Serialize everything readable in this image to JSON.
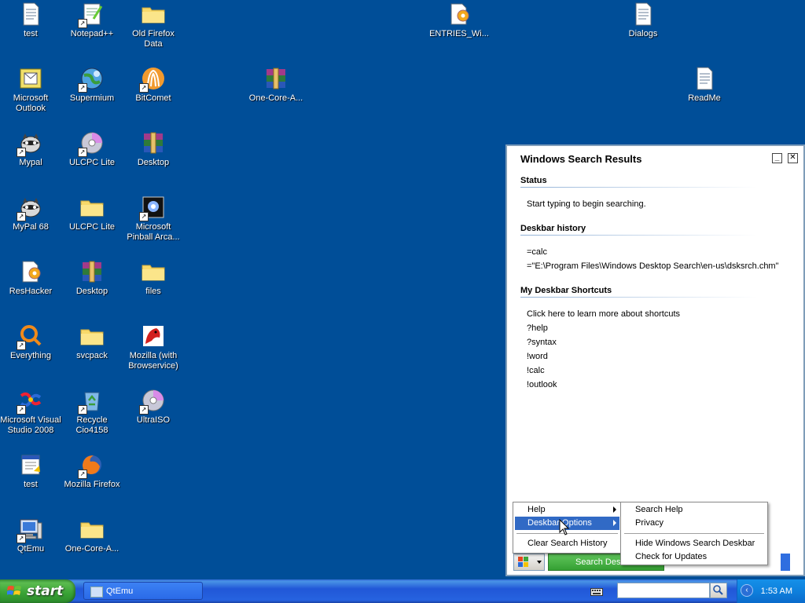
{
  "desktop": {
    "icons": [
      {
        "id": "test1",
        "label": "test",
        "kind": "doc"
      },
      {
        "id": "notepadpp",
        "label": "Notepad++",
        "kind": "notepad"
      },
      {
        "id": "oldfirefox",
        "label": "Old Firefox Data",
        "kind": "folder"
      },
      {
        "id": "entries",
        "label": "ENTRIES_Wi...",
        "kind": "reshack"
      },
      {
        "id": "dialogs",
        "label": "Dialogs",
        "kind": "doc"
      },
      {
        "id": "outlook",
        "label": "Microsoft Outlook",
        "kind": "outlook"
      },
      {
        "id": "supermium",
        "label": "Supermium",
        "kind": "globe"
      },
      {
        "id": "bitcomet",
        "label": "BitComet",
        "kind": "bitcomet"
      },
      {
        "id": "onecore1",
        "label": "One-Core-A...",
        "kind": "rar"
      },
      {
        "id": "readme",
        "label": "ReadMe",
        "kind": "doc"
      },
      {
        "id": "mypal",
        "label": "Mypal",
        "kind": "raccoon"
      },
      {
        "id": "ulcpc1",
        "label": "ULCPC Lite",
        "kind": "cd"
      },
      {
        "id": "desktop1",
        "label": "Desktop",
        "kind": "rar"
      },
      {
        "id": "mypal68",
        "label": "MyPal 68",
        "kind": "raccoon"
      },
      {
        "id": "ulcpc2",
        "label": "ULCPC Lite",
        "kind": "folder"
      },
      {
        "id": "pinball",
        "label": "Microsoft Pinball Arca...",
        "kind": "pinball"
      },
      {
        "id": "reshacker",
        "label": "ResHacker",
        "kind": "reshack"
      },
      {
        "id": "desktop2",
        "label": "Desktop",
        "kind": "rar"
      },
      {
        "id": "files",
        "label": "files",
        "kind": "folder"
      },
      {
        "id": "everything",
        "label": "Everything",
        "kind": "everything"
      },
      {
        "id": "svcpack",
        "label": "svcpack",
        "kind": "folder"
      },
      {
        "id": "mozilla",
        "label": "Mozilla (with Browservice)",
        "kind": "mozilla"
      },
      {
        "id": "msvs",
        "label": "Microsoft Visual Studio 2008",
        "kind": "vs"
      },
      {
        "id": "recycle",
        "label": "Recycle Cio4158",
        "kind": "recycle"
      },
      {
        "id": "ultraiso",
        "label": "UltraISO",
        "kind": "cd"
      },
      {
        "id": "test2",
        "label": "test",
        "kind": "batch"
      },
      {
        "id": "firefox",
        "label": "Mozilla Firefox",
        "kind": "firefox"
      },
      {
        "id": "qtemu",
        "label": "QtEmu",
        "kind": "computer"
      },
      {
        "id": "onecore2",
        "label": "One-Core-A...",
        "kind": "folder"
      }
    ]
  },
  "search_window": {
    "title": "Windows Search Results",
    "status_heading": "Status",
    "status_text": "Start typing to begin searching.",
    "history_heading": "Deskbar history",
    "history": [
      "=calc",
      "=\"E:\\Program Files\\Windows Desktop Search\\en-us\\dsksrch.chm\""
    ],
    "shortcuts_heading": "My Deskbar Shortcuts",
    "shortcuts": [
      "Click here to learn more about shortcuts",
      "?help",
      "?syntax",
      "!word",
      "!calc",
      "!outlook"
    ],
    "search_button_label": "Search Desk"
  },
  "menu": {
    "items": [
      "Help",
      "Deskbar Options",
      "Clear Search History"
    ],
    "highlighted": "Deskbar Options"
  },
  "submenu": {
    "items": [
      "Search Help",
      "Privacy",
      "Hide Windows Search Deskbar",
      "Check for Updates"
    ]
  },
  "taskbar": {
    "start_label": "start",
    "task_label": "QtEmu",
    "clock": "1:53 AM",
    "search_value": ""
  },
  "colors": {
    "desktop_bg": "#004e98",
    "menu_highlight": "#316ac5",
    "start_green": "#38a234"
  }
}
